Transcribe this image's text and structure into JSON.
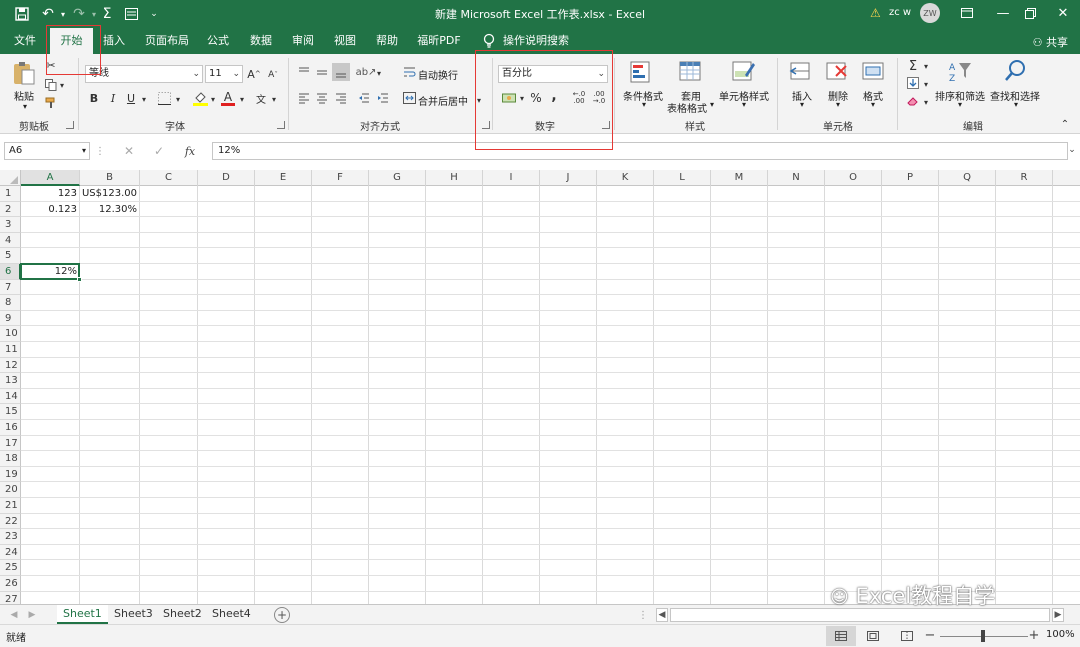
{
  "window": {
    "title": "新建 Microsoft Excel 工作表.xlsx  -  Excel",
    "user": "zc w",
    "avatar_initials": "ZW"
  },
  "tabs": [
    {
      "id": "file",
      "label": "文件"
    },
    {
      "id": "home",
      "label": "开始",
      "active": true
    },
    {
      "id": "insert",
      "label": "插入"
    },
    {
      "id": "page-layout",
      "label": "页面布局"
    },
    {
      "id": "formulas",
      "label": "公式"
    },
    {
      "id": "data",
      "label": "数据"
    },
    {
      "id": "review",
      "label": "审阅"
    },
    {
      "id": "view",
      "label": "视图"
    },
    {
      "id": "help",
      "label": "帮助"
    },
    {
      "id": "foxit",
      "label": "福昕PDF"
    },
    {
      "id": "tellme",
      "label": "操作说明搜索"
    }
  ],
  "share_label": "共享",
  "ribbon": {
    "clipboard": {
      "group": "剪贴板",
      "paste": "粘贴"
    },
    "font": {
      "group": "字体",
      "font_name": "等线",
      "font_size": "11",
      "bold": "B",
      "italic": "I",
      "underline": "U",
      "grow": "A",
      "shrink": "A"
    },
    "alignment": {
      "group": "对齐方式",
      "wrap": "自动换行",
      "merge": "合并后居中"
    },
    "number": {
      "group": "数字",
      "format": "百分比",
      "percent": "%",
      "comma": ","
    },
    "styles": {
      "group": "样式",
      "conditional": "条件格式",
      "table_line1": "套用",
      "table_line2": "表格格式",
      "cell_styles": "单元格样式"
    },
    "cells": {
      "group": "单元格",
      "insert": "插入",
      "delete": "删除",
      "format": "格式"
    },
    "editing": {
      "group": "编辑",
      "sort": "排序和筛选",
      "find": "查找和选择",
      "sigma": "Σ"
    }
  },
  "formula_bar": {
    "name_box": "A6",
    "value": "12%",
    "fx": "fx"
  },
  "columns": [
    "A",
    "B",
    "C",
    "D",
    "E",
    "F",
    "G",
    "H",
    "I",
    "J",
    "K",
    "L",
    "M",
    "N",
    "O",
    "P",
    "Q",
    "R"
  ],
  "rows": [
    "1",
    "2",
    "3",
    "4",
    "5",
    "6",
    "7",
    "8",
    "9",
    "10",
    "11",
    "12",
    "13",
    "14",
    "15",
    "16",
    "17",
    "18",
    "19",
    "20",
    "21",
    "22",
    "23",
    "24",
    "25",
    "26",
    "27"
  ],
  "cells": {
    "A1": "123",
    "B1": "US$123.00",
    "A2": "0.123",
    "B2": "12.30%",
    "A6": "12%"
  },
  "sheets": [
    {
      "label": "Sheet1",
      "active": true
    },
    {
      "label": "Sheet3"
    },
    {
      "label": "Sheet2"
    },
    {
      "label": "Sheet4"
    }
  ],
  "status": {
    "ready": "就绪",
    "zoom": "100%"
  },
  "watermark": "Excel教程自学",
  "colors": {
    "accent": "#217346",
    "highlight": "#e53935"
  }
}
